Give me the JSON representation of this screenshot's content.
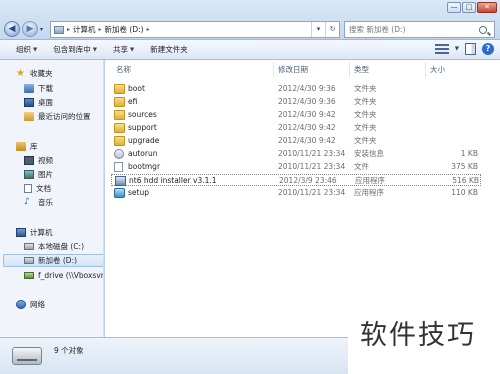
{
  "window": {
    "minimize": "—",
    "maximize": "□",
    "close": "✕"
  },
  "address_bar": {
    "crumbs": [
      "计算机",
      "新加卷 (D:)"
    ],
    "dropdown": "▾",
    "refresh": "↻"
  },
  "search": {
    "placeholder": "搜索 新加卷 (D:)"
  },
  "toolbar": {
    "organize": "组织",
    "include_in_library": "包含到库中",
    "share": "共享",
    "new_folder": "新建文件夹"
  },
  "sidebar": {
    "favorites": {
      "label": "收藏夹",
      "items": [
        "下载",
        "桌面",
        "最近访问的位置"
      ]
    },
    "libraries": {
      "label": "库",
      "items": [
        "视频",
        "图片",
        "文档",
        "音乐"
      ]
    },
    "computer": {
      "label": "计算机",
      "items": [
        "本地磁盘 (C:)",
        "新加卷 (D:)",
        "f_drive (\\\\Vboxsvr)"
      ]
    },
    "network": {
      "label": "网络"
    }
  },
  "columns": {
    "name": "名称",
    "date": "修改日期",
    "type": "类型",
    "size": "大小"
  },
  "files": [
    {
      "name": "boot",
      "date": "2012/4/30 9:36",
      "type": "文件夹",
      "size": "",
      "icon": "folder-icon"
    },
    {
      "name": "efi",
      "date": "2012/4/30 9:36",
      "type": "文件夹",
      "size": "",
      "icon": "folder-icon"
    },
    {
      "name": "sources",
      "date": "2012/4/30 9:42",
      "type": "文件夹",
      "size": "",
      "icon": "folder-icon"
    },
    {
      "name": "support",
      "date": "2012/4/30 9:42",
      "type": "文件夹",
      "size": "",
      "icon": "folder-icon"
    },
    {
      "name": "upgrade",
      "date": "2012/4/30 9:42",
      "type": "文件夹",
      "size": "",
      "icon": "folder-icon"
    },
    {
      "name": "autorun",
      "date": "2010/11/21 23:34",
      "type": "安装信息",
      "size": "1 KB",
      "icon": "settings-file-icon"
    },
    {
      "name": "bootmgr",
      "date": "2010/11/21 23:34",
      "type": "文件",
      "size": "375 KB",
      "icon": "file-icon"
    },
    {
      "name": "nt6 hdd installer v3.1.1",
      "date": "2012/3/9 23:46",
      "type": "应用程序",
      "size": "516 KB",
      "icon": "app-icon"
    },
    {
      "name": "setup",
      "date": "2010/11/21 23:34",
      "type": "应用程序",
      "size": "110 KB",
      "icon": "setup-icon"
    }
  ],
  "details": {
    "item_count": "9 个对象"
  },
  "watermark": {
    "text": "软件技巧"
  }
}
